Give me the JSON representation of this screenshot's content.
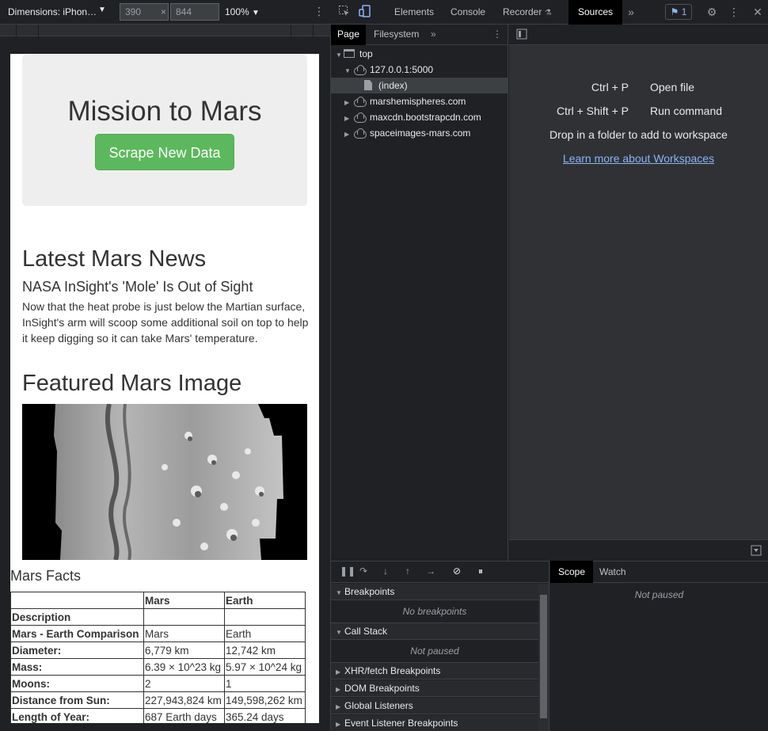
{
  "device_toolbar": {
    "dimensions_label": "Dimensions: iPhon…",
    "width": "390",
    "height": "844",
    "times": "×",
    "zoom": "100%"
  },
  "page": {
    "jumbotron_title": "Mission to Mars",
    "scrape_button": "Scrape New Data",
    "news_section_title": "Latest Mars News",
    "news_headline": "NASA InSight's 'Mole' Is Out of Sight",
    "news_body": "Now that the heat probe is just below the Martian surface, InSight's arm will scoop some additional soil on top to help it keep digging so it can take Mars' temperature.",
    "featured_title": "Featured Mars Image",
    "facts_title": "Mars Facts",
    "facts_table": {
      "header": [
        "",
        "Mars",
        "Earth"
      ],
      "rows": [
        [
          "Description",
          "",
          ""
        ],
        [
          "Mars - Earth Comparison",
          "Mars",
          "Earth"
        ],
        [
          "Diameter:",
          "6,779 km",
          "12,742 km"
        ],
        [
          "Mass:",
          "6.39 × 10^23 kg",
          "5.97 × 10^24 kg"
        ],
        [
          "Moons:",
          "2",
          "1"
        ],
        [
          "Distance from Sun:",
          "227,943,824 km",
          "149,598,262 km"
        ],
        [
          "Length of Year:",
          "687 Earth days",
          "365.24 days"
        ]
      ]
    }
  },
  "devtools": {
    "tabs": [
      "Elements",
      "Console",
      "Recorder",
      "Sources"
    ],
    "active_tab": "Sources",
    "issues_count": "1",
    "navigator_tabs": [
      "Page",
      "Filesystem"
    ],
    "tree": {
      "top": "top",
      "origin": "127.0.0.1:5000",
      "index": "(index)",
      "domains": [
        "marshemispheres.com",
        "maxcdn.bootstrapcdn.com",
        "spaceimages-mars.com"
      ]
    },
    "editor": {
      "shortcut1_key": "Ctrl + P",
      "shortcut1_label": "Open file",
      "shortcut2_key": "Ctrl + Shift + P",
      "shortcut2_label": "Run command",
      "drop_text": "Drop in a folder to add to workspace",
      "learn_link": "Learn more about Workspaces"
    },
    "debugger": {
      "breakpoints": "Breakpoints",
      "no_breakpoints": "No breakpoints",
      "call_stack": "Call Stack",
      "not_paused": "Not paused",
      "xhr": "XHR/fetch Breakpoints",
      "dom": "DOM Breakpoints",
      "global": "Global Listeners",
      "event": "Event Listener Breakpoints"
    },
    "scope_tabs": [
      "Scope",
      "Watch"
    ],
    "scope_not_paused": "Not paused"
  },
  "colors": {
    "scrape_button": "#5cb85c",
    "link": "#8ab4f8",
    "devtools_bg": "#202124"
  }
}
